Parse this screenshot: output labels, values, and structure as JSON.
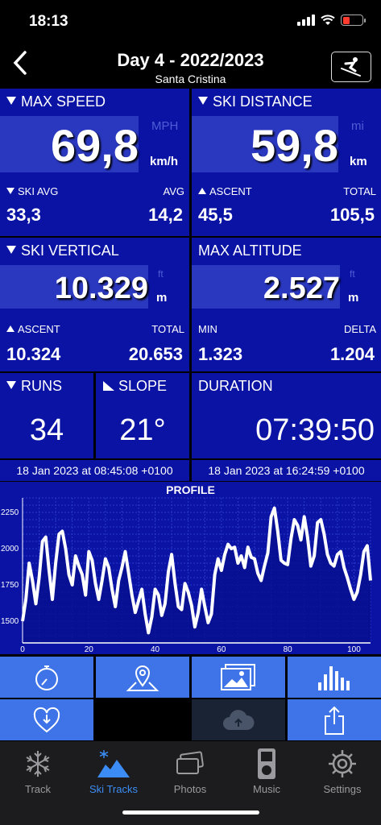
{
  "status": {
    "time": "18:13"
  },
  "header": {
    "title": "Day 4 - 2022/2023",
    "subtitle": "Santa Cristina"
  },
  "max_speed": {
    "label": "MAX SPEED",
    "value": "69,8",
    "unit_alt": "MPH",
    "unit": "km/h",
    "left_label": "SKI AVG",
    "left_value": "33,3",
    "right_label": "AVG",
    "right_value": "14,2"
  },
  "ski_distance": {
    "label": "SKI DISTANCE",
    "value": "59,8",
    "unit_alt": "mi",
    "unit": "km",
    "left_label": "ASCENT",
    "left_value": "45,5",
    "right_label": "TOTAL",
    "right_value": "105,5"
  },
  "ski_vertical": {
    "label": "SKI VERTICAL",
    "value": "10.329",
    "unit_alt": "ft",
    "unit": "m",
    "left_label": "ASCENT",
    "left_value": "10.324",
    "right_label": "TOTAL",
    "right_value": "20.653"
  },
  "max_altitude": {
    "label": "MAX ALTITUDE",
    "value": "2.527",
    "unit_alt": "ft",
    "unit": "m",
    "left_label": "MIN",
    "left_value": "1.323",
    "right_label": "DELTA",
    "right_value": "1.204"
  },
  "runs": {
    "label": "RUNS",
    "value": "34"
  },
  "slope": {
    "label": "SLOPE",
    "value": "21°"
  },
  "duration": {
    "label": "DURATION",
    "value": "07:39:50"
  },
  "start_time": "18 Jan 2023 at 08:45:08 +0100",
  "end_time": "18 Jan 2023 at 16:24:59 +0100",
  "chart_data": {
    "type": "area",
    "title": "PROFILE",
    "xlim": [
      0,
      105
    ],
    "ylim": [
      1350,
      2350
    ],
    "x_ticks": [
      "0",
      "20",
      "40",
      "60",
      "80",
      "100"
    ],
    "y_ticks": [
      "1500",
      "1750",
      "2000",
      "2250"
    ],
    "x": [
      0,
      1,
      2,
      3,
      4,
      5,
      6,
      7,
      8,
      9,
      10,
      11,
      12,
      13,
      14,
      15,
      16,
      17,
      18,
      19,
      20,
      21,
      22,
      23,
      24,
      25,
      26,
      27,
      28,
      29,
      30,
      31,
      32,
      33,
      34,
      35,
      36,
      37,
      38,
      39,
      40,
      41,
      42,
      43,
      44,
      45,
      46,
      47,
      48,
      49,
      50,
      51,
      52,
      53,
      54,
      55,
      56,
      57,
      58,
      59,
      60,
      61,
      62,
      63,
      64,
      65,
      66,
      67,
      68,
      69,
      70,
      71,
      72,
      73,
      74,
      75,
      76,
      77,
      78,
      79,
      80,
      81,
      82,
      83,
      84,
      85,
      86,
      87,
      88,
      89,
      90,
      91,
      92,
      93,
      94,
      95,
      96,
      97,
      98,
      99,
      100,
      101,
      102,
      103,
      104,
      105
    ],
    "y": [
      1500,
      1650,
      1900,
      1780,
      1620,
      1800,
      2050,
      2080,
      1850,
      1650,
      1900,
      2100,
      2120,
      2000,
      1820,
      1750,
      1950,
      1880,
      1820,
      1680,
      1980,
      1920,
      1760,
      1650,
      1780,
      1930,
      1870,
      1720,
      1600,
      1780,
      1870,
      1980,
      1830,
      1680,
      1560,
      1640,
      1720,
      1550,
      1420,
      1530,
      1720,
      1680,
      1540,
      1620,
      1840,
      1960,
      1760,
      1600,
      1580,
      1760,
      1700,
      1610,
      1460,
      1560,
      1720,
      1600,
      1490,
      1550,
      1820,
      1930,
      1850,
      1960,
      2030,
      2000,
      2010,
      1900,
      1950,
      1870,
      2010,
      1940,
      1930,
      1830,
      1780,
      1880,
      1970,
      2220,
      2280,
      2120,
      1920,
      1900,
      1890,
      2070,
      2200,
      2160,
      2060,
      2220,
      2080,
      1880,
      1950,
      2180,
      2200,
      2100,
      1960,
      1900,
      1880,
      1960,
      1980,
      1870,
      1800,
      1720,
      1650,
      1700,
      1820,
      1980,
      2020,
      1780
    ],
    "area_color": "#071190",
    "line_color": "#ffffff"
  },
  "tabs": [
    {
      "label": "Track",
      "icon": "snowflake-icon"
    },
    {
      "label": "Ski Tracks",
      "icon": "ski-tracks-icon"
    },
    {
      "label": "Photos",
      "icon": "photos-icon"
    },
    {
      "label": "Music",
      "icon": "music-icon"
    },
    {
      "label": "Settings",
      "icon": "gear-icon"
    }
  ],
  "colors": {
    "panel": "#0a13a3",
    "value_box": "#2a38c0",
    "action": "#3f74e8",
    "active_tab": "#3b8df5"
  }
}
